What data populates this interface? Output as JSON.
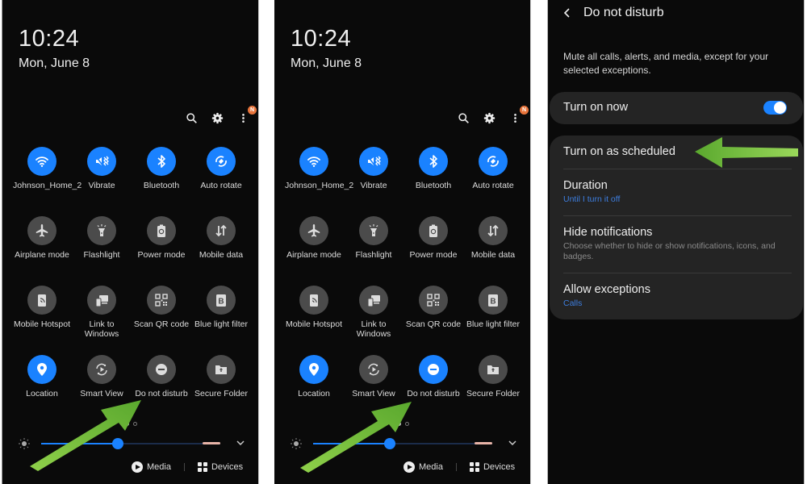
{
  "colors": {
    "active_tile": "#1a82ff",
    "inactive_tile": "#4b4b4b",
    "badge": "#e8743b",
    "link_blue": "#3d7ee0",
    "arrow_green": "#7cc242"
  },
  "quick_panel": {
    "time": "10:24",
    "date": "Mon, June 8",
    "header_icons": [
      "search-icon",
      "gear-icon",
      "more-icon"
    ],
    "notification_badge": "N",
    "tiles": [
      {
        "label": "Johnson_Home_2",
        "icon": "wifi-icon",
        "on": true
      },
      {
        "label": "Vibrate",
        "icon": "vibrate-icon",
        "on": true
      },
      {
        "label": "Bluetooth",
        "icon": "bluetooth-icon",
        "on": true
      },
      {
        "label": "Auto rotate",
        "icon": "rotate-icon",
        "on": true
      },
      {
        "label": "Airplane mode",
        "icon": "airplane-icon",
        "on": false
      },
      {
        "label": "Flashlight",
        "icon": "flashlight-icon",
        "on": false
      },
      {
        "label": "Power mode",
        "icon": "battery-icon",
        "on": false
      },
      {
        "label": "Mobile data",
        "icon": "data-arrows-icon",
        "on": false
      },
      {
        "label": "Mobile Hotspot",
        "icon": "hotspot-icon",
        "on": false
      },
      {
        "label": "Link to Windows",
        "icon": "link-windows-icon",
        "on": false
      },
      {
        "label": "Scan QR code",
        "icon": "qr-icon",
        "on": false
      },
      {
        "label": "Blue light filter",
        "icon": "blue-light-icon",
        "on": false
      },
      {
        "label": "Location",
        "icon": "location-icon",
        "on": true
      },
      {
        "label": "Smart View",
        "icon": "smart-view-icon",
        "on": false
      },
      {
        "label": "Do not disturb",
        "icon": "dnd-icon",
        "on": false
      },
      {
        "label": "Secure Folder",
        "icon": "folder-icon",
        "on": false
      }
    ],
    "page_count": 2,
    "active_page": 1,
    "brightness_percent": 43,
    "media_label": "Media",
    "devices_label": "Devices"
  },
  "quick_panel_after": {
    "dnd_on": true
  },
  "dnd_settings": {
    "title": "Do not disturb",
    "description": "Mute all calls, alerts, and media, except for your selected exceptions.",
    "turn_on_now": {
      "label": "Turn on now",
      "enabled": true
    },
    "rows": [
      {
        "title": "Turn on as scheduled",
        "subtitle": ""
      },
      {
        "title": "Duration",
        "subtitle": "Until I turn it off"
      },
      {
        "title": "Hide notifications",
        "subtitle": "Choose whether to hide or show notifications, icons, and badges."
      },
      {
        "title": "Allow exceptions",
        "subtitle": "Calls"
      }
    ]
  }
}
